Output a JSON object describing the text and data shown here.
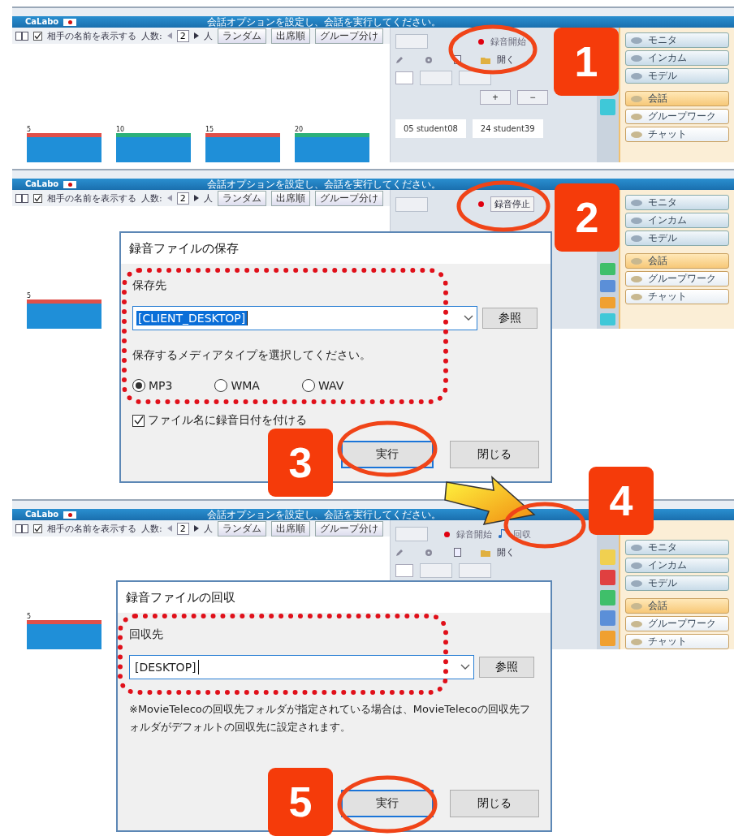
{
  "screens": [
    {
      "app_name": "CaLabo",
      "message": "会話オプションを設定し、会話を実行してください。",
      "toolbar": {
        "show_names": {
          "label": "相手の名前を表示する",
          "checked": true
        },
        "count_label": "人数:",
        "count": "2",
        "unit": "人",
        "buttons": [
          "ランダム",
          "出席順",
          "グループ分け"
        ]
      },
      "record": {
        "label": "録音開始",
        "recording": false
      },
      "tools": {
        "open_label": "開く"
      },
      "zoom_buttons": [
        "+",
        "−"
      ],
      "students": [
        "05 student08",
        "24 student39"
      ],
      "side_buttons": [
        {
          "label": "モニタ",
          "kind": "device",
          "selected": false
        },
        {
          "label": "インカム",
          "kind": "device",
          "selected": false
        },
        {
          "label": "モデル",
          "kind": "device",
          "selected": false
        },
        {
          "label": "会話",
          "kind": "mode",
          "selected": true
        },
        {
          "label": "グループワーク",
          "kind": "mode",
          "selected": false
        },
        {
          "label": "チャット",
          "kind": "mode",
          "selected": false
        }
      ],
      "thumbnails": [
        {
          "number": "5",
          "color": "#e0504a"
        },
        {
          "number": "10",
          "color": "#2cb07a"
        },
        {
          "number": "15",
          "color": "#e0504a"
        },
        {
          "number": "20",
          "color": "#2cb07a"
        }
      ]
    },
    {
      "app_name": "CaLabo",
      "message": "会話オプションを設定し、会話を実行してください。",
      "toolbar": {
        "show_names": {
          "label": "相手の名前を表示する",
          "checked": true
        },
        "count_label": "人数:",
        "count": "2",
        "unit": "人",
        "buttons": [
          "ランダム",
          "出席順",
          "グループ分け"
        ]
      },
      "record": {
        "label": "録音停止",
        "recording": true
      },
      "side_buttons": [
        {
          "label": "モニタ",
          "kind": "device",
          "selected": false
        },
        {
          "label": "インカム",
          "kind": "device",
          "selected": false
        },
        {
          "label": "モデル",
          "kind": "device",
          "selected": false
        },
        {
          "label": "会話",
          "kind": "mode",
          "selected": true
        },
        {
          "label": "グループワーク",
          "kind": "mode",
          "selected": false
        },
        {
          "label": "チャット",
          "kind": "mode",
          "selected": false
        }
      ],
      "thumbnails": [
        {
          "number": "5",
          "color": "#e0504a"
        }
      ],
      "dialog": {
        "kind": "save",
        "title": "録音ファイルの保存",
        "destination_label": "保存先",
        "destination": {
          "value": "[CLIENT_DESKTOP]",
          "selected": true
        },
        "browse": "参照",
        "media_prompt": "保存するメディアタイプを選択してください。",
        "media_types": [
          {
            "label": "MP3",
            "selected": true
          },
          {
            "label": "WMA",
            "selected": false
          },
          {
            "label": "WAV",
            "selected": false
          }
        ],
        "date_option": {
          "label": "ファイル名に録音日付を付ける",
          "checked": true
        },
        "buttons": [
          {
            "label": "実行",
            "default": true
          },
          {
            "label": "閉じる",
            "default": false
          }
        ]
      }
    },
    {
      "app_name": "CaLabo",
      "message": "会話オプションを設定し、会話を実行してください。",
      "toolbar": {
        "show_names": {
          "label": "相手の名前を表示する",
          "checked": true
        },
        "count_label": "人数:",
        "count": "2",
        "unit": "人",
        "buttons": [
          "ランダム",
          "出席順",
          "グループ分け"
        ]
      },
      "record": {
        "label": "録音開始",
        "recording": false
      },
      "collect": {
        "label": "回収"
      },
      "tools": {
        "open_label": "開く"
      },
      "side_buttons": [
        {
          "label": "モニタ",
          "kind": "device",
          "selected": false
        },
        {
          "label": "インカム",
          "kind": "device",
          "selected": false
        },
        {
          "label": "モデル",
          "kind": "device",
          "selected": false
        },
        {
          "label": "会話",
          "kind": "mode",
          "selected": true
        },
        {
          "label": "グループワーク",
          "kind": "mode",
          "selected": false
        },
        {
          "label": "チャット",
          "kind": "mode",
          "selected": false
        }
      ],
      "thumbnails": [
        {
          "number": "5",
          "color": "#e0504a"
        }
      ],
      "dialog": {
        "kind": "collect",
        "title": "録音ファイルの回収",
        "destination_label": "回収先",
        "destination": {
          "value": "[DESKTOP]",
          "selected": false
        },
        "browse": "参照",
        "note": "※MovieTelecoの回収先フォルダが指定されている場合は、MovieTelecoの回収先フォルダがデフォルトの回収先に設定されます。",
        "buttons": [
          {
            "label": "実行",
            "default": true
          },
          {
            "label": "閉じる",
            "default": false
          }
        ]
      }
    }
  ],
  "callouts": [
    {
      "number": "1"
    },
    {
      "number": "2"
    },
    {
      "number": "3"
    },
    {
      "number": "4"
    },
    {
      "number": "5"
    }
  ]
}
